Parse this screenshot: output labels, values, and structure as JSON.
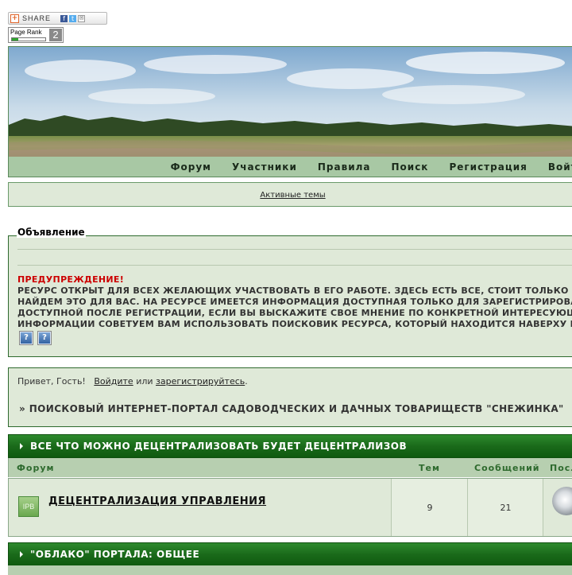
{
  "share": {
    "label": "SHARE",
    "plus_icon": "+"
  },
  "pagerank": {
    "label": "Page Rank",
    "value": "2",
    "fill_fraction": 0.2
  },
  "nav": {
    "items": [
      "Форум",
      "Участники",
      "Правила",
      "Поиск",
      "Регистрация",
      "Войти"
    ]
  },
  "active_topics": "Активные темы",
  "announcement": {
    "title": "Объявление",
    "warning": "ПРЕДУПРЕЖДЕНИЕ!",
    "lines": [
      "РЕСУРС ОТКРЫТ ДЛЯ ВСЕХ ЖЕЛАЮЩИХ УЧАСТВОВАТЬ В ЕГО РАБОТЕ. ЗДЕСЬ ЕСТЬ ВСЕ, СТОИТ ТОЛЬКО ПРО",
      "НАЙДЕМ ЭТО ДЛЯ ВАС. НА РЕСУРСЕ ИМЕЕТСЯ ИНФОРМАЦИЯ ДОСТУПНАЯ ТОЛЬКО ДЛЯ ЗАРЕГИСТРИРОВАНН",
      "ДОСТУПНОЙ ПОСЛЕ РЕГИСТРАЦИИ, ЕСЛИ ВЫ ВЫСКАЖИТЕ СВОЕ МНЕНИЕ ПО КОНКРЕТНОЙ ИНТЕРЕСУЮЩЕЙ",
      "ИНФОРМАЦИИ СОВЕТУЕМ ВАМ ИСПОЛЬЗОВАТЬ ПОИСКОВИК РЕСУРСА, КОТОРЫЙ НАХОДИТСЯ НАВЕРХУ ПОД"
    ],
    "help_button": "?"
  },
  "greeting": {
    "hello": "Привет, Гость!",
    "login": "Войдите",
    "or": "или",
    "register": "зарегистрируйтесь",
    "dot": ".",
    "portal": "» ПОИСКОВЫЙ ИНТЕРНЕТ-ПОРТАЛ САДОВОДЧЕСКИХ И ДАЧНЫХ ТОВАРИЩЕСТВ \"СНЕЖИНКА\""
  },
  "category1": {
    "title": "ВСЕ ЧТО МОЖНО ДЕЦЕНТРАЛИЗОВАТЬ БУДЕТ ДЕЦЕНТРАЛИЗОВ",
    "columns": {
      "forum": "Форум",
      "topics": "Тем",
      "posts": "Сообщений",
      "last": "Посл"
    },
    "forums": [
      {
        "icon_text": "IPB",
        "title": "ДЕЦЕНТРАЛИЗАЦИЯ УПРАВЛЕНИЯ",
        "topics": "9",
        "posts": "21"
      }
    ]
  },
  "category2": {
    "title": "\"ОБЛАКО\" ПОРТАЛА: ОБЩЕЕ"
  },
  "colors": {
    "header_green": "#1a6a1a",
    "panel_bg": "#dfe9d8",
    "nav_bg": "#a8c8a4",
    "warning_red": "#cc0000"
  }
}
